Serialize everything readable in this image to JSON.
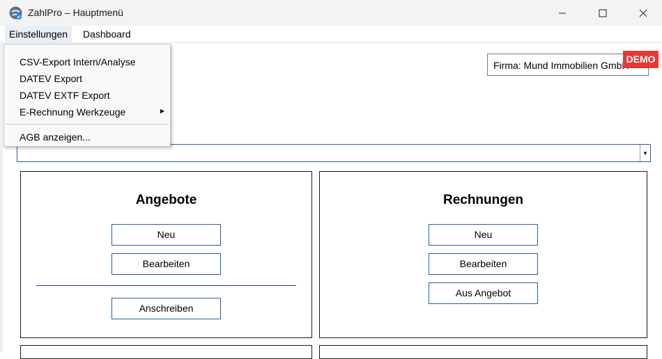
{
  "window": {
    "title": "ZahlPro – Hauptmenü"
  },
  "menubar": {
    "items": [
      "Einstellungen",
      "Dashboard"
    ]
  },
  "dropdown": {
    "items": [
      "CSV-Export Intern/Analyse",
      "DATEV Export",
      "DATEV EXTF Export",
      "E-Rechnung Werkzeuge",
      "AGB anzeigen..."
    ]
  },
  "company": {
    "label": "Firma: Mund Immobilien GmbH",
    "badge": "DEMO"
  },
  "panels": {
    "angebote": {
      "title": "Angebote",
      "buttons": [
        "Neu",
        "Bearbeiten",
        "Anschreiben"
      ]
    },
    "rechnungen": {
      "title": "Rechnungen",
      "buttons": [
        "Neu",
        "Bearbeiten",
        "Aus Angebot"
      ]
    }
  },
  "colors": {
    "accent": "#2c5aa0",
    "demo": "#e53935",
    "divider": "#1f3f8f"
  }
}
